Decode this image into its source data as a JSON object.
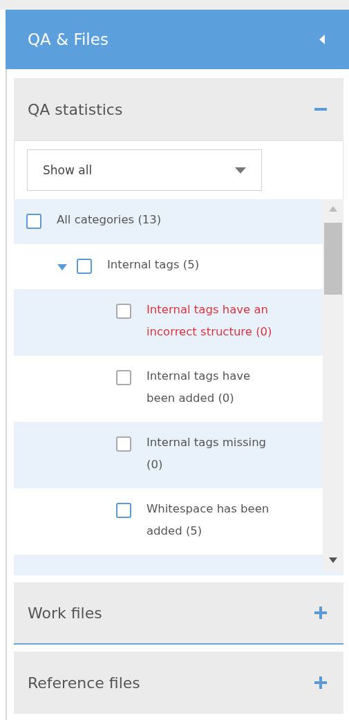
{
  "panel": {
    "title": "QA & Files",
    "collapsed": false
  },
  "sections": [
    {
      "title": "QA statistics",
      "expanded": true,
      "filter": {
        "value": "Show all"
      },
      "tree": [
        {
          "label": "All categories (13)",
          "checked": false,
          "disabled": false,
          "error": false,
          "children": [
            {
              "label": "Internal tags (5)",
              "checked": false,
              "disabled": false,
              "error": false,
              "expanded": true,
              "children": [
                {
                  "label": "Internal tags have an incorrect structure (0)",
                  "checked": false,
                  "disabled": true,
                  "error": true
                },
                {
                  "label": "Internal tags have been added (0)",
                  "checked": false,
                  "disabled": true,
                  "error": false
                },
                {
                  "label": "Internal tags missing (0)",
                  "checked": false,
                  "disabled": true,
                  "error": false
                },
                {
                  "label": "Whitespace has been added (5)",
                  "checked": false,
                  "disabled": false,
                  "error": false
                }
              ]
            }
          ]
        }
      ]
    },
    {
      "title": "Work files",
      "expanded": false
    },
    {
      "title": "Reference files",
      "expanded": false
    }
  ]
}
